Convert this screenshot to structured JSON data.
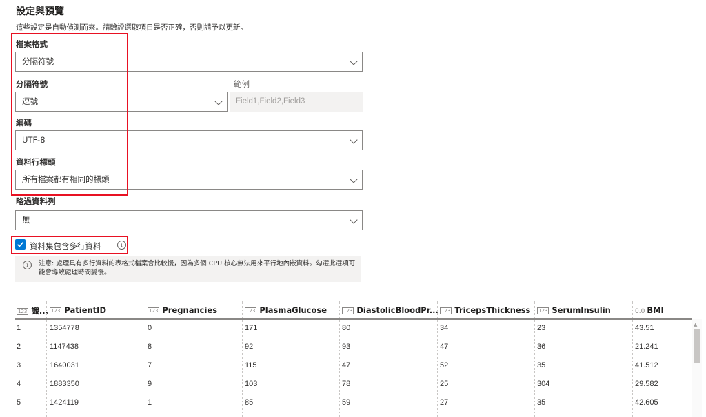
{
  "header": {
    "title": "設定與預覽",
    "subtitle": "這些設定是自動偵測而來。請驗證選取項目是否正確，否則請予以更新。"
  },
  "form": {
    "file_format": {
      "label": "檔案格式",
      "value": "分隔符號"
    },
    "delimiter": {
      "label": "分隔符號",
      "value": "逗號"
    },
    "example": {
      "label": "範例",
      "value": "Field1,Field2,Field3"
    },
    "encoding": {
      "label": "編碼",
      "value": "UTF-8"
    },
    "column_headers": {
      "label": "資料行標頭",
      "value": "所有檔案都有相同的標頭"
    },
    "skip_rows": {
      "label": "略過資料列",
      "value": "無"
    },
    "multiline": {
      "label": "資料集包含多行資料",
      "checked": true,
      "note": "注意: 處理具有多行資料的表格式檔案會比較慢，因為多個 CPU 核心無法用來平行地內嵌資料。勾選此選項可能會導致處理時間變慢。"
    }
  },
  "icons": {
    "info": "info-icon",
    "chevron": "chevron-down-icon",
    "check": "check-icon"
  },
  "colors": {
    "accent": "#0078d4",
    "highlight": "#e81123"
  },
  "preview": {
    "columns": [
      {
        "name": "識...",
        "type": "123"
      },
      {
        "name": "PatientID",
        "type": "123"
      },
      {
        "name": "Pregnancies",
        "type": "123"
      },
      {
        "name": "PlasmaGlucose",
        "type": "123"
      },
      {
        "name": "DiastolicBloodPr...",
        "type": "123"
      },
      {
        "name": "TricepsThickness",
        "type": "123"
      },
      {
        "name": "SerumInsulin",
        "type": "123"
      },
      {
        "name": "BMI",
        "type": "0.0"
      }
    ],
    "rows": [
      [
        "1",
        "1354778",
        "0",
        "171",
        "80",
        "34",
        "23",
        "43.51"
      ],
      [
        "2",
        "1147438",
        "8",
        "92",
        "93",
        "47",
        "36",
        "21.241"
      ],
      [
        "3",
        "1640031",
        "7",
        "115",
        "47",
        "52",
        "35",
        "41.512"
      ],
      [
        "4",
        "1883350",
        "9",
        "103",
        "78",
        "25",
        "304",
        "29.582"
      ],
      [
        "5",
        "1424119",
        "1",
        "85",
        "59",
        "27",
        "35",
        "42.605"
      ]
    ]
  }
}
